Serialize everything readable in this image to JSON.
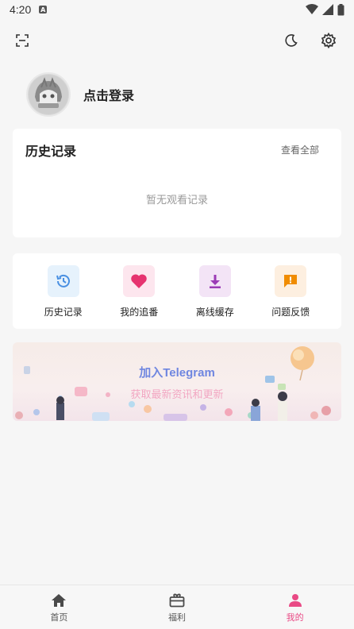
{
  "status_bar": {
    "time": "4:20",
    "notification_icon": "A"
  },
  "top_actions": {
    "scan_icon": "scan-icon",
    "theme_icon": "moon-icon",
    "settings_icon": "gear-icon"
  },
  "profile": {
    "login_label": "点击登录"
  },
  "history": {
    "title": "历史记录",
    "view_all": "查看全部",
    "empty": "暂无观看记录"
  },
  "menu": [
    {
      "label": "历史记录",
      "icon": "history-icon",
      "color": "#4a90e2",
      "bg": "#e6f2fc"
    },
    {
      "label": "我的追番",
      "icon": "heart-icon",
      "color": "#e6336f",
      "bg": "#fde6ee"
    },
    {
      "label": "离线缓存",
      "icon": "download-icon",
      "color": "#9b3bb5",
      "bg": "#f3e4f6"
    },
    {
      "label": "问题反馈",
      "icon": "feedback-icon",
      "color": "#f08c00",
      "bg": "#fdefe0"
    }
  ],
  "banner": {
    "title": "加入Telegram",
    "subtitle": "获取最新资讯和更新"
  },
  "bottom_nav": [
    {
      "label": "首页",
      "icon": "home-icon"
    },
    {
      "label": "福利",
      "icon": "gift-icon"
    },
    {
      "label": "我的",
      "icon": "person-icon",
      "active": true
    }
  ],
  "colors": {
    "accent": "#e94a85",
    "background": "#f6f6f6"
  }
}
